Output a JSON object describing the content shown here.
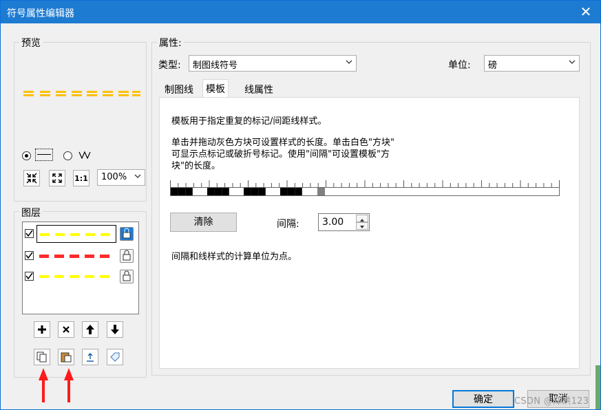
{
  "window": {
    "title": "符号属性编辑器",
    "close": "✕"
  },
  "preview": {
    "label": "预览",
    "zoom": "100%",
    "btn_fit": "1:1",
    "line_color": "#ffc000"
  },
  "layers": {
    "label": "图层",
    "items": [
      {
        "checked": true,
        "color": "#ffff00",
        "selected": true
      },
      {
        "checked": true,
        "color": "#ff2a2a",
        "selected": false
      },
      {
        "checked": true,
        "color": "#ffff00",
        "selected": false
      }
    ],
    "btn_add": "+",
    "btn_remove": "×",
    "btn_up": "↑",
    "btn_down": "↓"
  },
  "properties": {
    "label": "属性:",
    "type_label": "类型:",
    "type_value": "制图线符号",
    "unit_label": "单位:",
    "unit_value": "磅",
    "tabs": [
      "制图线",
      "模板",
      "线属性"
    ],
    "active_tab": 1
  },
  "template_panel": {
    "desc1": "模板用于指定重复的标记/间距线样式。",
    "desc2_line1": "单击并拖动灰色方块可设置样式的长度。单击白色\"方块\"",
    "desc2_line2": "可显示点标记或破折号标记。使用\"间隔\"可设置模板\"方",
    "desc2_line3": "块\"的长度。",
    "clear_button": "清除",
    "interval_label": "间隔:",
    "interval_value": "3.00",
    "note": "间隔和线样式的计算单位为点。",
    "pattern": [
      1,
      1,
      1,
      0,
      0,
      1,
      1,
      1,
      0,
      0,
      1,
      1,
      1,
      0,
      0,
      1,
      1,
      1,
      0,
      0
    ]
  },
  "footer": {
    "ok": "确定",
    "cancel": "取消",
    "watermark": "CSDN @郑洪123"
  }
}
